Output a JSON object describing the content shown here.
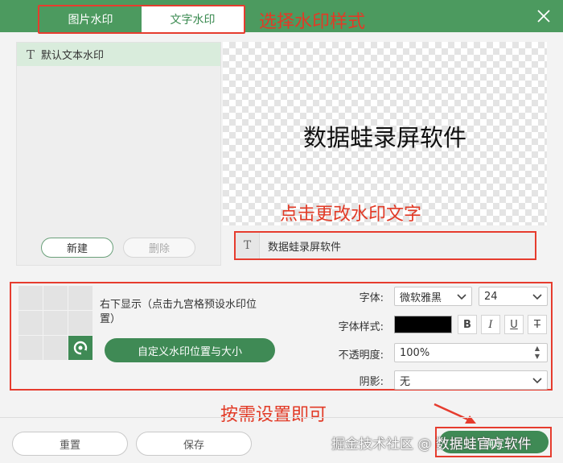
{
  "tabs": [
    {
      "label": "图片水印",
      "active": false
    },
    {
      "label": "文字水印",
      "active": true
    }
  ],
  "annotations": {
    "style_hint": "选择水印样式",
    "text_hint": "点击更改水印文字",
    "settings_hint": "按需设置即可"
  },
  "watermark_list": {
    "items": [
      {
        "icon": "text-icon",
        "label": "默认文本水印",
        "selected": true
      }
    ],
    "new_label": "新建",
    "delete_label": "删除"
  },
  "preview": {
    "text": "数据蛙录屏软件"
  },
  "text_field": {
    "value": "数据蛙录屏软件"
  },
  "position": {
    "grid_selected": "bottom-right",
    "description": "右下显示（点击九宫格预设水印位置）",
    "custom_button": "自定义水印位置与大小"
  },
  "font": {
    "font_label": "字体:",
    "font_value": "微软雅黑",
    "size_value": "24",
    "style_label": "字体样式:",
    "color": "#000000",
    "style_buttons": [
      "B",
      "I",
      "U",
      "T"
    ],
    "opacity_label": "不透明度:",
    "opacity_value": "100%",
    "shadow_label": "阴影:",
    "shadow_value": "无"
  },
  "footer": {
    "reset_label": "重置",
    "save_label": "保存",
    "confirm_label": "确定",
    "credit": "掘金技术社区 @ 数据蛙官方软件"
  },
  "colors": {
    "accent": "#3f8a55",
    "annotation": "#e63c2e"
  }
}
